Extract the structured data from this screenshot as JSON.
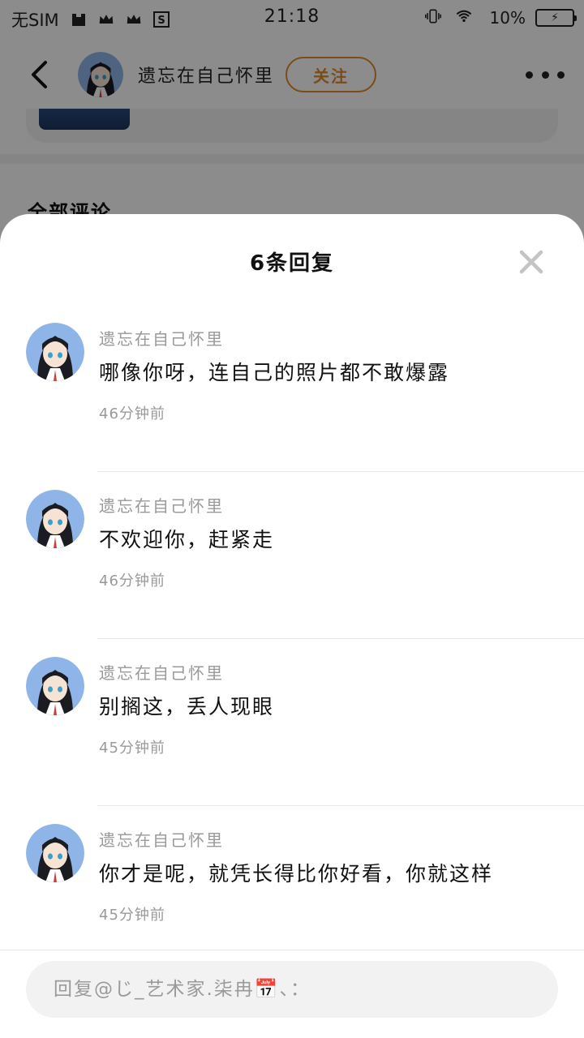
{
  "status_bar": {
    "sim": "无SIM",
    "time": "21:18",
    "battery": "10%",
    "icons": [
      "bag-icon",
      "crown-icon",
      "crown-icon",
      "s-icon",
      "vibrate-icon",
      "wifi-icon",
      "battery-charging-icon"
    ]
  },
  "nav": {
    "user_name": "遗忘在自己怀里",
    "follow_label": "关注"
  },
  "background": {
    "section_title": "全部评论"
  },
  "sheet": {
    "title": "6条回复",
    "replies": [
      {
        "name": "遗忘在自己怀里",
        "text": "哪像你呀，连自己的照片都不敢爆露",
        "time": "46分钟前"
      },
      {
        "name": "遗忘在自己怀里",
        "text": "不欢迎你，赶紧走",
        "time": "46分钟前"
      },
      {
        "name": "遗忘在自己怀里",
        "text": "别搁这，丢人现眼",
        "time": "45分钟前"
      },
      {
        "name": "遗忘在自己怀里",
        "text": "你才是呢，就凭长得比你好看，你就这样",
        "time": "45分钟前"
      }
    ],
    "input_placeholder": "回复@じ_艺术家.柒冉📅、："
  },
  "colors": {
    "accent": "#e08a2c",
    "secondary_text": "#999999",
    "input_bg": "#f2f2f2"
  }
}
